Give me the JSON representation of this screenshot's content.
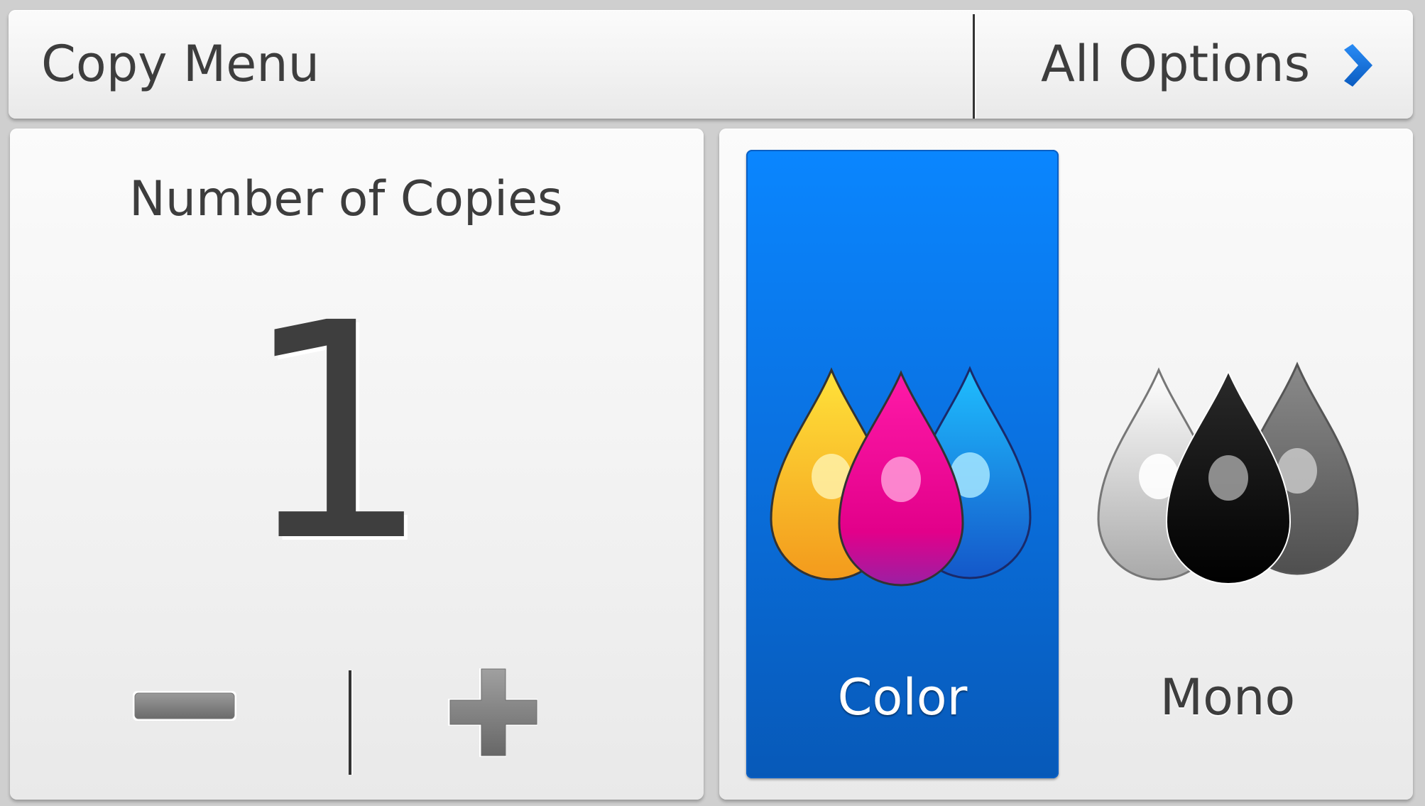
{
  "header": {
    "title": "Copy Menu",
    "all_options_label": "All Options"
  },
  "copies": {
    "label": "Number of Copies",
    "value": "1"
  },
  "color_mode": {
    "options": [
      {
        "label": "Color",
        "selected": true
      },
      {
        "label": "Mono",
        "selected": false
      }
    ]
  },
  "colors": {
    "accent": "#0a7cf0",
    "text": "#3d3d3d",
    "panel": "#f3f3f3",
    "chevron": "#1171de"
  },
  "icons": {
    "chevron": "chevron-right-icon",
    "minus": "minus-icon",
    "plus": "plus-icon",
    "color_drops": "color-ink-drops-icon",
    "mono_drops": "mono-ink-drops-icon"
  }
}
